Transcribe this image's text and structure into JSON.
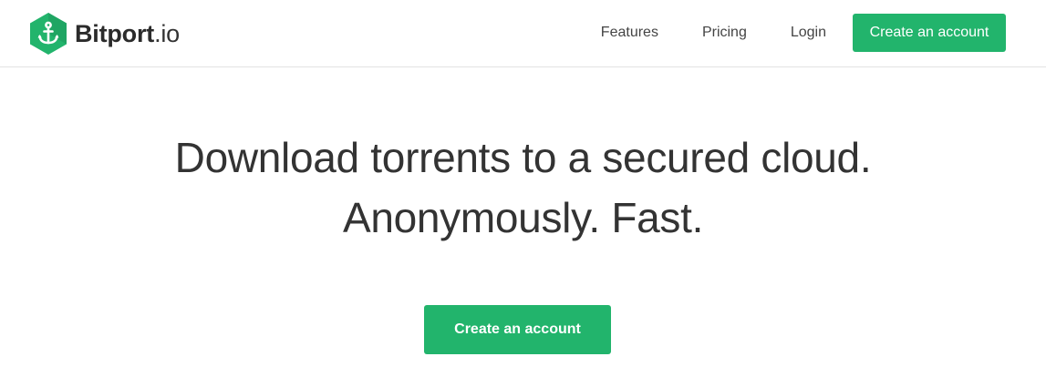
{
  "brand": {
    "name_part1": "Bitport",
    "name_part2": ".io",
    "logo_icon": "anchor-hexagon-icon",
    "accent_color": "#22b46c"
  },
  "nav": {
    "items": [
      {
        "label": "Features"
      },
      {
        "label": "Pricing"
      },
      {
        "label": "Login"
      }
    ],
    "cta_label": "Create an account"
  },
  "hero": {
    "headline_line1": "Download torrents to a secured cloud.",
    "headline_line2": "Anonymously. Fast.",
    "cta_label": "Create an account"
  }
}
